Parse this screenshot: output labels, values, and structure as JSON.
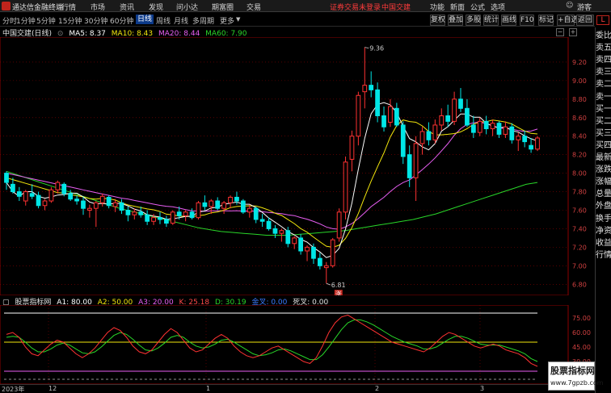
{
  "menubar": {
    "app_title": "通达信金融终端",
    "items": [
      "行情",
      "市场",
      "资讯",
      "发现",
      "问小达",
      "期富圈",
      "交易"
    ],
    "alert": "证券交易未登录",
    "stock_name": "中国交建",
    "right_items": [
      "功能",
      "新面",
      "公式",
      "选项",
      "游客"
    ]
  },
  "timeframes": {
    "items": [
      "分时",
      "1分钟",
      "5分钟",
      "15分钟",
      "30分钟",
      "60分钟",
      "日线",
      "周线",
      "月线",
      "多周期",
      "更多"
    ],
    "active": "日线"
  },
  "toolbar_buttons": [
    "复权",
    "叠加",
    "多股",
    "统计",
    "画线",
    "F10",
    "标记",
    "+自选",
    "返回"
  ],
  "legend": {
    "title": "中国交建(日线)",
    "ma5": "MA5: 8.37",
    "ma10": "MA10: 8.43",
    "ma20": "MA20: 8.44",
    "ma60": "MA60: 7.90",
    "colors": {
      "ma5": "#ffffff",
      "ma10": "#f2e60c",
      "ma20": "#e85ef2",
      "ma60": "#29d629"
    }
  },
  "price_axis": {
    "ticks": [
      "9.20",
      "9.00",
      "8.80",
      "8.60",
      "8.40",
      "8.20",
      "8.00",
      "7.80",
      "7.60",
      "7.40",
      "7.20",
      "7.00",
      "6.80"
    ]
  },
  "annotations": {
    "high": "9.36",
    "low": "6.81",
    "badge": "涨"
  },
  "indicator": {
    "name": "股票指标网",
    "a1": "A1: 80.00",
    "a2": "A2: 50.00",
    "a3": "A3: 20.00",
    "k": "K: 25.18",
    "d": "D: 30.19",
    "golden": "金叉: 0.00",
    "dead": "死叉: 0.00",
    "ticks": [
      "75.00",
      "60.00",
      "45.00",
      "30.00"
    ]
  },
  "right_panel": [
    "委比",
    "卖五",
    "卖四",
    "卖三",
    "卖二",
    "卖一",
    "买一",
    "买二",
    "买三",
    "买四",
    "最新",
    "涨跌",
    "涨幅",
    "总量",
    "外盘",
    "换手",
    "净资",
    "收益",
    "行情"
  ],
  "date_axis": [
    "2023年",
    "12",
    "1",
    "2",
    "3"
  ],
  "watermark": {
    "line1": "股票指标网",
    "line2": "www.7gpzb.com"
  },
  "colors": {
    "up": "#ff3232",
    "down": "#00e6e6",
    "bg": "#000000",
    "grid": "#8b0000"
  },
  "chart_data": {
    "type": "candlestick",
    "ylim": [
      6.75,
      9.4
    ],
    "candles": [
      [
        8.0,
        8.02,
        7.82,
        7.9
      ],
      [
        7.88,
        7.95,
        7.78,
        7.8
      ],
      [
        7.8,
        7.85,
        7.7,
        7.75
      ],
      [
        7.7,
        7.82,
        7.65,
        7.8
      ],
      [
        7.78,
        7.88,
        7.72,
        7.75
      ],
      [
        7.76,
        7.8,
        7.62,
        7.65
      ],
      [
        7.65,
        7.72,
        7.6,
        7.7
      ],
      [
        7.7,
        7.85,
        7.68,
        7.82
      ],
      [
        7.82,
        7.92,
        7.78,
        7.9
      ],
      [
        7.88,
        7.9,
        7.75,
        7.78
      ],
      [
        7.78,
        7.82,
        7.7,
        7.72
      ],
      [
        7.72,
        7.76,
        7.66,
        7.7
      ],
      [
        7.7,
        7.74,
        7.55,
        7.62
      ],
      [
        7.6,
        7.66,
        7.52,
        7.62
      ],
      [
        7.62,
        7.7,
        7.42,
        7.68
      ],
      [
        7.68,
        7.78,
        7.64,
        7.75
      ],
      [
        7.74,
        7.76,
        7.62,
        7.65
      ],
      [
        7.64,
        7.72,
        7.58,
        7.68
      ],
      [
        7.68,
        7.72,
        7.56,
        7.6
      ],
      [
        7.6,
        7.64,
        7.48,
        7.55
      ],
      [
        7.55,
        7.62,
        7.5,
        7.58
      ],
      [
        7.58,
        7.64,
        7.52,
        7.55
      ],
      [
        7.55,
        7.6,
        7.44,
        7.48
      ],
      [
        7.48,
        7.56,
        7.44,
        7.52
      ],
      [
        7.52,
        7.58,
        7.45,
        7.5
      ],
      [
        7.5,
        7.54,
        7.42,
        7.46
      ],
      [
        7.46,
        7.6,
        7.44,
        7.58
      ],
      [
        7.58,
        7.64,
        7.5,
        7.54
      ],
      [
        7.54,
        7.6,
        7.48,
        7.58
      ],
      [
        7.58,
        7.62,
        7.5,
        7.52
      ],
      [
        7.52,
        7.7,
        7.5,
        7.68
      ],
      [
        7.68,
        7.76,
        7.6,
        7.64
      ],
      [
        7.64,
        7.72,
        7.56,
        7.7
      ],
      [
        7.7,
        7.74,
        7.6,
        7.62
      ],
      [
        7.62,
        7.7,
        7.56,
        7.68
      ],
      [
        7.68,
        7.76,
        7.62,
        7.74
      ],
      [
        7.74,
        7.8,
        7.66,
        7.7
      ],
      [
        7.7,
        7.72,
        7.56,
        7.58
      ],
      [
        7.58,
        7.66,
        7.52,
        7.62
      ],
      [
        7.62,
        7.64,
        7.46,
        7.5
      ],
      [
        7.5,
        7.56,
        7.42,
        7.48
      ],
      [
        7.48,
        7.52,
        7.38,
        7.4
      ],
      [
        7.4,
        7.44,
        7.3,
        7.35
      ],
      [
        7.35,
        7.4,
        7.26,
        7.38
      ],
      [
        7.38,
        7.42,
        7.2,
        7.24
      ],
      [
        7.24,
        7.32,
        7.18,
        7.3
      ],
      [
        7.3,
        7.34,
        7.12,
        7.16
      ],
      [
        7.16,
        7.22,
        7.05,
        7.2
      ],
      [
        7.2,
        7.24,
        7.02,
        7.08
      ],
      [
        7.08,
        7.14,
        6.96,
        7.0
      ],
      [
        6.98,
        7.04,
        6.81,
        7.0
      ],
      [
        7.0,
        7.3,
        6.98,
        7.28
      ],
      [
        7.3,
        7.62,
        7.26,
        7.58
      ],
      [
        7.58,
        8.18,
        7.5,
        8.12
      ],
      [
        8.15,
        8.46,
        8.02,
        8.4
      ],
      [
        8.4,
        8.88,
        8.3,
        8.84
      ],
      [
        8.88,
        9.36,
        8.7,
        8.95
      ],
      [
        8.95,
        9.1,
        8.82,
        8.9
      ],
      [
        8.9,
        8.98,
        8.55,
        8.62
      ],
      [
        8.62,
        8.72,
        8.45,
        8.5
      ],
      [
        8.55,
        8.8,
        8.5,
        8.72
      ],
      [
        8.7,
        8.76,
        8.5,
        8.52
      ],
      [
        8.52,
        8.56,
        8.1,
        8.18
      ],
      [
        8.2,
        8.3,
        7.85,
        7.95
      ],
      [
        7.95,
        8.4,
        7.7,
        8.32
      ],
      [
        8.32,
        8.5,
        8.2,
        8.45
      ],
      [
        8.45,
        8.55,
        8.3,
        8.36
      ],
      [
        8.36,
        8.58,
        8.32,
        8.52
      ],
      [
        8.52,
        8.7,
        8.46,
        8.62
      ],
      [
        8.62,
        8.74,
        8.5,
        8.56
      ],
      [
        8.56,
        8.88,
        8.52,
        8.8
      ],
      [
        8.8,
        8.92,
        8.66,
        8.7
      ],
      [
        8.7,
        8.8,
        8.5,
        8.52
      ],
      [
        8.52,
        8.62,
        8.38,
        8.44
      ],
      [
        8.44,
        8.6,
        8.4,
        8.56
      ],
      [
        8.56,
        8.62,
        8.42,
        8.48
      ],
      [
        8.48,
        8.58,
        8.4,
        8.54
      ],
      [
        8.54,
        8.56,
        8.38,
        8.42
      ],
      [
        8.42,
        8.56,
        8.38,
        8.5
      ],
      [
        8.5,
        8.54,
        8.32,
        8.36
      ],
      [
        8.36,
        8.44,
        8.24,
        8.4
      ],
      [
        8.4,
        8.46,
        8.28,
        8.34
      ],
      [
        8.3,
        8.38,
        8.22,
        8.26
      ],
      [
        8.26,
        8.4,
        8.24,
        8.38
      ]
    ],
    "ma60": [
      8.02,
      7.98,
      7.94,
      7.9,
      7.86,
      7.82,
      7.78,
      7.74,
      7.7,
      7.66,
      7.62,
      7.59,
      7.56,
      7.53,
      7.5,
      7.47,
      7.44,
      7.41,
      7.39,
      7.37,
      7.36,
      7.35,
      7.34,
      7.33,
      7.33,
      7.33,
      7.34,
      7.35,
      7.36,
      7.37,
      7.38,
      7.4,
      7.42,
      7.44,
      7.46,
      7.48,
      7.5,
      7.53,
      7.56,
      7.6,
      7.64,
      7.68,
      7.72,
      7.76,
      7.8,
      7.84,
      7.88,
      7.9
    ],
    "kd_k": [
      58,
      60,
      55,
      45,
      38,
      36,
      42,
      48,
      52,
      50,
      44,
      38,
      34,
      38,
      44,
      52,
      60,
      65,
      62,
      55,
      46,
      40,
      38,
      42,
      50,
      58,
      64,
      60,
      52,
      44,
      40,
      42,
      48,
      54,
      58,
      54,
      46,
      40,
      36,
      34,
      36,
      40,
      44,
      46,
      42,
      38,
      34,
      30,
      28,
      34,
      46,
      60,
      70,
      76,
      78,
      74,
      70,
      66,
      62,
      58,
      54,
      50,
      48,
      46,
      44,
      42,
      40,
      44,
      50,
      56,
      60,
      58,
      54,
      50,
      46,
      44,
      46,
      48,
      46,
      42,
      40,
      38,
      34,
      28,
      25
    ],
    "kd_d": [
      55,
      56,
      55,
      50,
      44,
      40,
      40,
      43,
      47,
      49,
      47,
      43,
      39,
      38,
      40,
      45,
      51,
      57,
      60,
      58,
      53,
      47,
      42,
      41,
      44,
      49,
      55,
      57,
      55,
      50,
      46,
      44,
      45,
      48,
      52,
      53,
      50,
      46,
      42,
      38,
      36,
      37,
      39,
      42,
      43,
      41,
      38,
      35,
      32,
      32,
      37,
      45,
      54,
      63,
      70,
      73,
      73,
      71,
      68,
      64,
      60,
      56,
      53,
      50,
      48,
      46,
      43,
      43,
      45,
      49,
      53,
      56,
      56,
      54,
      51,
      48,
      47,
      47,
      47,
      45,
      43,
      41,
      38,
      33,
      30
    ]
  }
}
